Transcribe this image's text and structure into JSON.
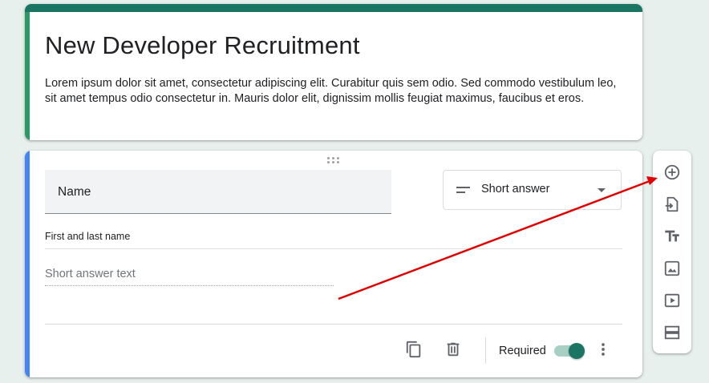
{
  "form": {
    "title": "New Developer Recruitment",
    "description": "Lorem ipsum dolor sit amet, consectetur adipiscing elit. Curabitur quis sem odio. Sed commodo vestibulum leo, sit amet tempus odio consectetur in. Mauris dolor elit, dignissim mollis feugiat maximus, faucibus et eros.",
    "header_color": "#1a7563"
  },
  "question": {
    "title": "Name",
    "type": "Short answer",
    "description": "First and last name",
    "answer_placeholder": "Short answer text",
    "required_label": "Required",
    "required": true,
    "accent_color": "#4285f4"
  },
  "icons": {
    "duplicate": "copy-icon",
    "delete": "trash-icon",
    "more": "more-vert-icon",
    "drag": "drag-handle-icon"
  },
  "toolbar": {
    "items": [
      "add-question-icon",
      "import-questions-icon",
      "add-title-icon",
      "add-image-icon",
      "add-video-icon",
      "add-section-icon"
    ]
  },
  "annotation": {
    "arrow_color": "#e00000"
  }
}
